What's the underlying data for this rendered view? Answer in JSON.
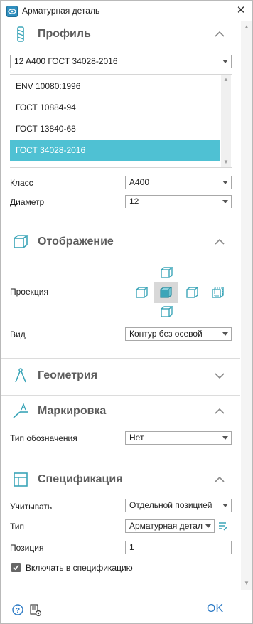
{
  "window": {
    "title": "Арматурная деталь",
    "close_label": "✕"
  },
  "colors": {
    "accent": "#4fc1d3",
    "ok": "#2f7cc6",
    "icon": "#3ba5b8"
  },
  "profile": {
    "title": "Профиль",
    "standard_selected": "12 A400 ГОСТ 34028-2016",
    "standards": [
      "ENV 10080:1996",
      "ГОСТ 10884-94",
      "ГОСТ 13840-68",
      "ГОСТ 34028-2016"
    ],
    "selected_standard_index": 3,
    "class_label": "Класс",
    "class_value": "A400",
    "diameter_label": "Диаметр",
    "diameter_value": "12"
  },
  "display": {
    "title": "Отображение",
    "projection_label": "Проекция",
    "view_label": "Вид",
    "view_value": "Контур без осевой"
  },
  "geometry": {
    "title": "Геометрия"
  },
  "marking": {
    "title": "Маркировка",
    "designation_label": "Тип обозначения",
    "designation_value": "Нет"
  },
  "specification": {
    "title": "Спецификация",
    "account_label": "Учитывать",
    "account_value": "Отдельной позицией",
    "type_label": "Тип",
    "type_value": "Арматурная детал",
    "position_label": "Позиция",
    "position_value": "1",
    "include_label": "Включать в спецификацию",
    "include_checked": true
  },
  "footer": {
    "ok_label": "OK"
  }
}
